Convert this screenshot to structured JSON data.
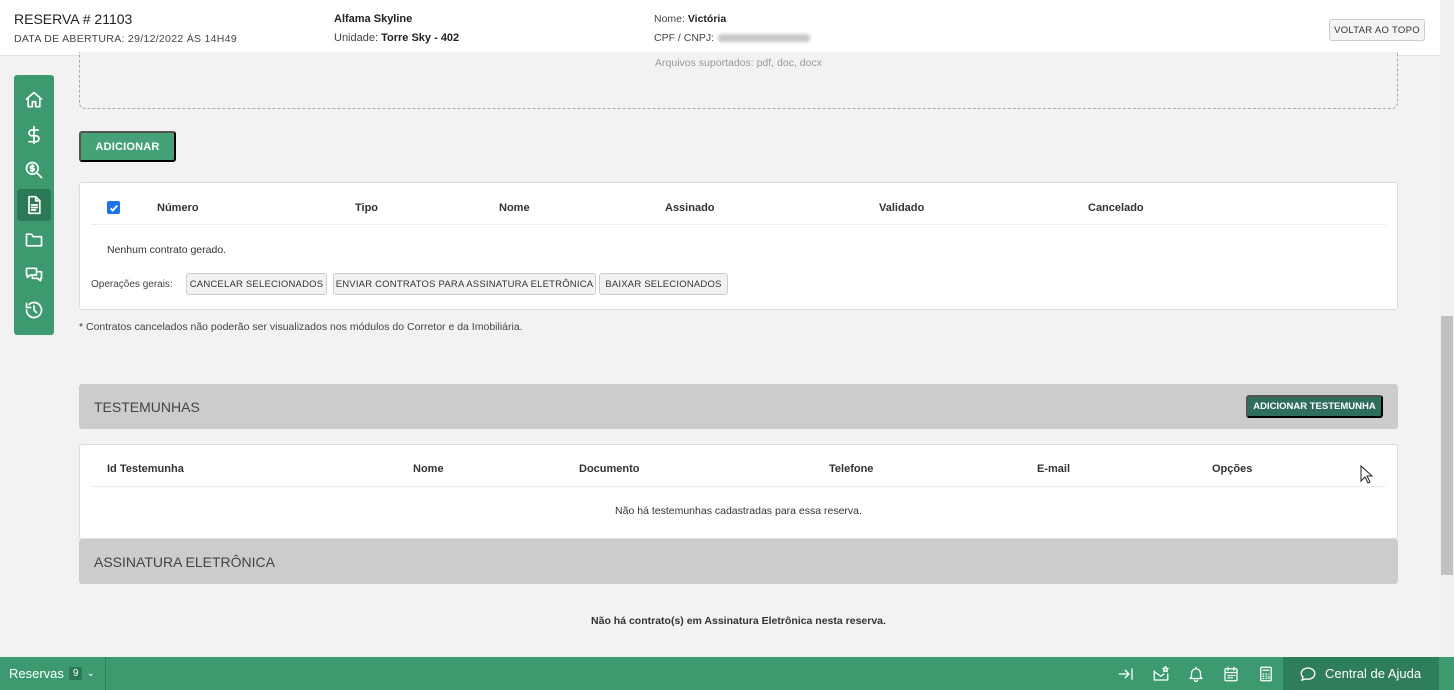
{
  "header": {
    "title": "RESERVA # 21103",
    "opening_date": "DATA DE ABERTURA: 29/12/2022 ÀS 14H49",
    "enterprise": "Alfama Skyline",
    "unit_label": "Unidade:",
    "unit_value": "Torre Sky - 402",
    "client_name_label": "Nome:",
    "client_name_value": "Victória",
    "cpf_label": "CPF / CNPJ:",
    "back_to_top": "VOLTAR AO TOPO"
  },
  "sidebar": {
    "items": [
      {
        "icon": "home-icon"
      },
      {
        "icon": "dollar-icon"
      },
      {
        "icon": "search-dollar-icon"
      },
      {
        "icon": "document-icon",
        "active": true
      },
      {
        "icon": "folder-icon"
      },
      {
        "icon": "chat-icon"
      },
      {
        "icon": "history-icon"
      }
    ]
  },
  "upload": {
    "supported": "Arquivos suportados: pdf, doc, docx"
  },
  "contracts": {
    "add_button": "ADICIONAR",
    "columns": [
      "Número",
      "Tipo",
      "Nome",
      "Assinado",
      "Validado",
      "Cancelado"
    ],
    "empty": "Nenhum contrato gerado.",
    "ops_label": "Operações gerais:",
    "ops_buttons": [
      "CANCELAR SELECIONADOS",
      "ENVIAR CONTRATOS PARA ASSINATURA ELETRÔNICA",
      "BAIXAR SELECIONADOS"
    ],
    "note": "* Contratos cancelados não poderão ser visualizados nos módulos do Corretor e da Imobiliária."
  },
  "witnesses": {
    "title": "TESTEMUNHAS",
    "add_button": "ADICIONAR TESTEMUNHA",
    "columns": [
      "Id Testemunha",
      "Nome",
      "Documento",
      "Telefone",
      "E-mail",
      "Opções"
    ],
    "empty": "Não há testemunhas cadastradas para essa reserva."
  },
  "esign": {
    "title": "ASSINATURA ELETRÔNICA",
    "empty": "Não há contrato(s) em Assinatura Eletrônica nesta reserva."
  },
  "bottombar": {
    "reservas_label": "Reservas",
    "reservas_count": "9",
    "help_label": "Central de Ajuda"
  },
  "colors": {
    "primary": "#3c9a6e",
    "dark_green": "#2f6e5c",
    "section_bg": "#cccccc"
  }
}
